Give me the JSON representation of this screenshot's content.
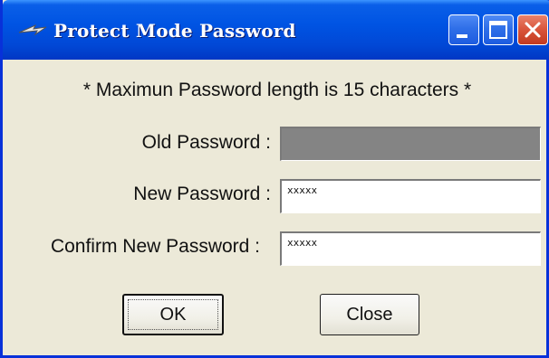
{
  "window": {
    "title": "Protect Mode Password",
    "icon": "arrow-icon",
    "controls": [
      "minimize",
      "maximize",
      "close"
    ]
  },
  "note": "* Maximun Password length is 15 characters *",
  "fields": {
    "old": {
      "label": "Old Password :",
      "value": "",
      "disabled": true
    },
    "new": {
      "label": "New Password :",
      "value": "xxxxx"
    },
    "confirm": {
      "label": "Confirm New Password :",
      "value": "xxxxx"
    }
  },
  "buttons": {
    "ok": "OK",
    "close": "Close"
  },
  "colors": {
    "title_bar": "#0054e3",
    "dialog_bg": "#ece9d8",
    "disabled_field": "#848484"
  }
}
